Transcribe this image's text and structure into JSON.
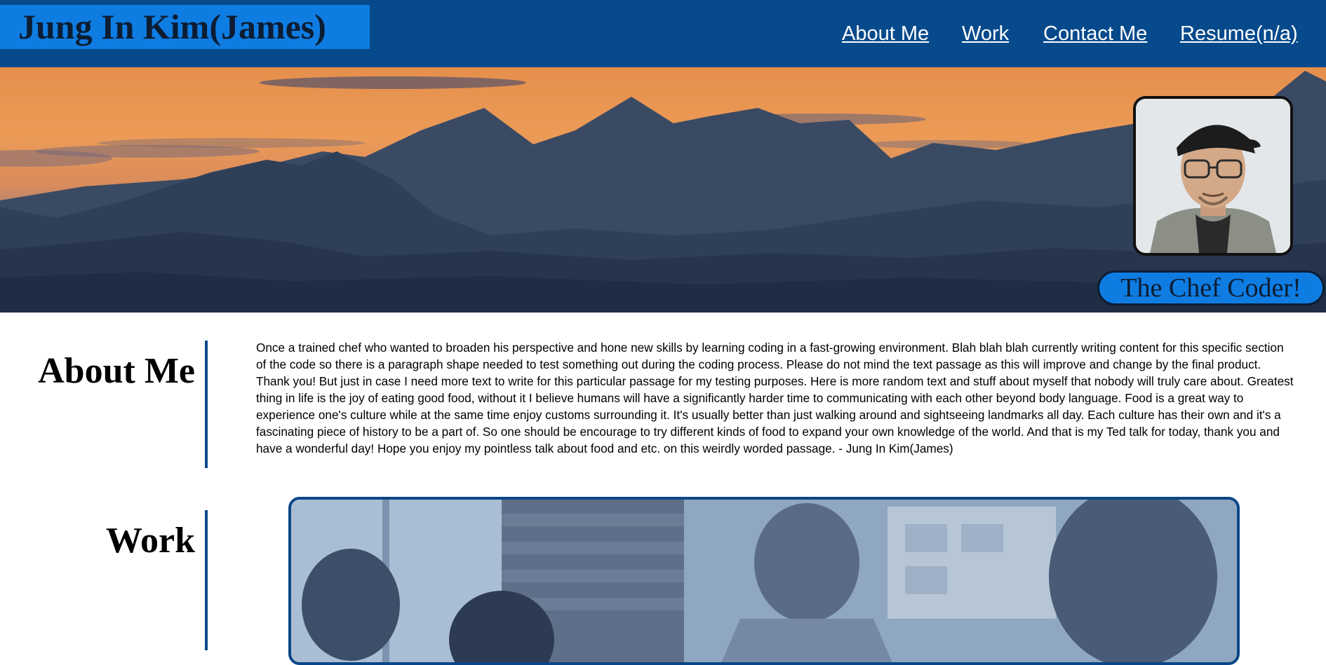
{
  "header": {
    "site_title": "Jung In Kim(James)",
    "nav": [
      {
        "label": "About Me"
      },
      {
        "label": "Work"
      },
      {
        "label": "Contact Me"
      },
      {
        "label": "Resume(n/a)"
      }
    ]
  },
  "hero": {
    "tagline": "The Chef Coder!",
    "avatar": "profile-photo"
  },
  "about": {
    "heading": "About Me",
    "text": "Once a trained chef who wanted to broaden his perspective and hone new skills by learning coding in a fast-growing environment. Blah blah blah currently writing content for this specific section of the code so there is a paragraph shape needed to test something out during the coding process. Please do not mind the text passage as this will improve and change by the final product. Thank you! But just in case I need more text to write for this particular passage for my testing purposes. Here is more random text and stuff about myself that nobody will truly care about. Greatest thing in life is the joy of eating good food, without it I believe humans will have a significantly harder time to communicating with each other beyond body language. Food is a great way to experience one's culture while at the same time enjoy customs surrounding it. It's usually better than just walking around and sightseeing landmarks all day. Each culture has their own and it's a fascinating piece of history to be a part of. So one should be encourage to try different kinds of food to expand your own knowledge of the world. And that is my Ted talk for today, thank you and have a wonderful day! Hope you enjoy my pointless talk about food and etc. on this weirdly worded passage. - Jung In Kim(James)"
  },
  "work": {
    "heading": "Work"
  },
  "colors": {
    "header_bg": "#064a8c",
    "accent": "#0f7ce2",
    "divider": "#0b4788"
  }
}
